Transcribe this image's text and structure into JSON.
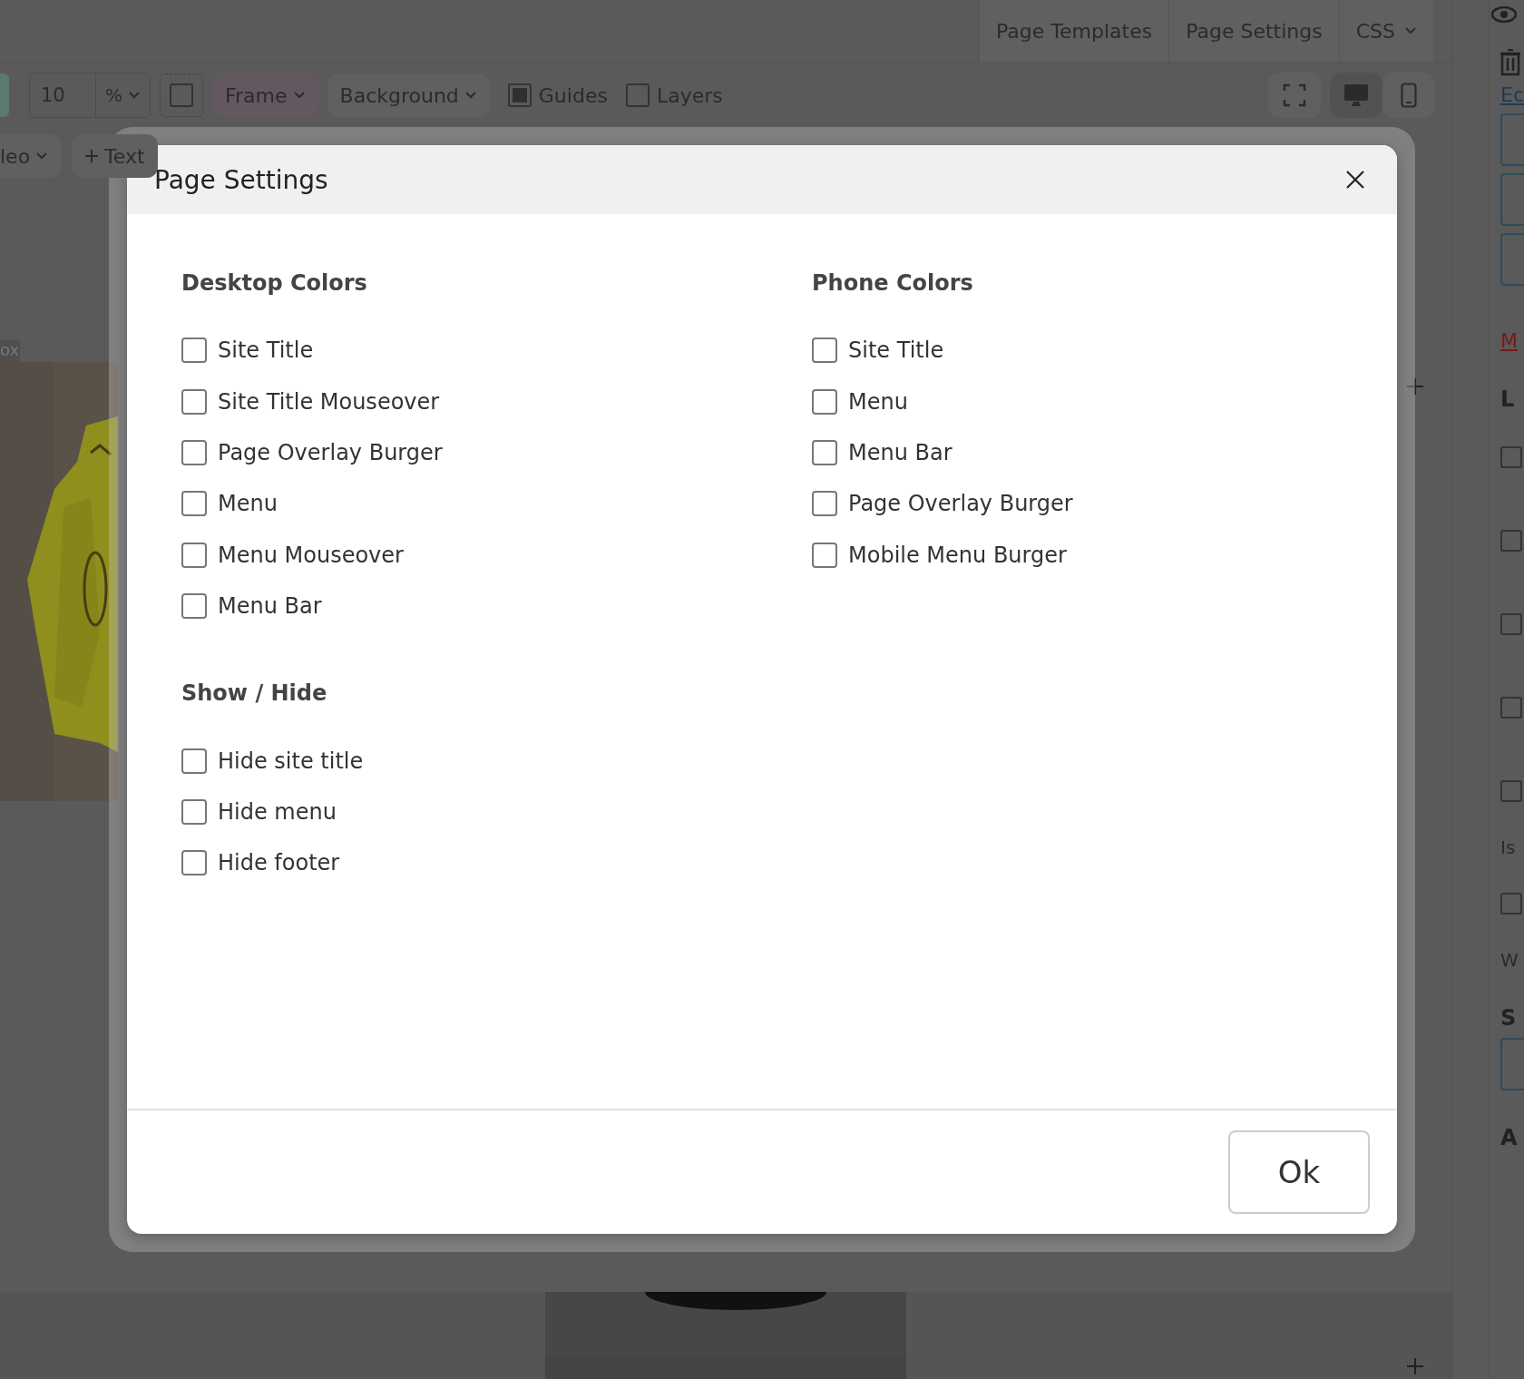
{
  "top_tabs": [
    "Page Templates",
    "Page Settings"
  ],
  "css_menu": "CSS",
  "toolbar": {
    "size_value": "10",
    "size_unit": "%",
    "frame": "Frame",
    "background": "Background",
    "toggles": [
      {
        "label": "Guides",
        "checked": true
      },
      {
        "label": "Layers",
        "checked": false
      }
    ]
  },
  "insert_bar": {
    "video_menu": "leo",
    "add_text": "Text"
  },
  "canvas_label": "ox",
  "sidebar": [
    {
      "kind": "link",
      "text": "Ec"
    },
    {
      "kind": "field"
    },
    {
      "kind": "field"
    },
    {
      "kind": "field"
    },
    {
      "kind": "alert",
      "text": "M"
    },
    {
      "kind": "heading",
      "text": "L"
    },
    {
      "kind": "check",
      "checked": false
    },
    {
      "kind": "check",
      "checked": false
    },
    {
      "kind": "check",
      "checked": false
    },
    {
      "kind": "check",
      "checked": false
    },
    {
      "kind": "check",
      "checked": false
    },
    {
      "kind": "text",
      "text": "Is"
    },
    {
      "kind": "check",
      "checked": false
    },
    {
      "kind": "text",
      "text": "W"
    },
    {
      "kind": "heading",
      "text": "S"
    },
    {
      "kind": "field"
    },
    {
      "kind": "heading",
      "text": "A"
    }
  ],
  "dialog": {
    "title": "Page Settings",
    "columns": [
      [
        {
          "heading": "Desktop Colors",
          "options": [
            {
              "label": "Site Title",
              "checked": false
            },
            {
              "label": "Site Title Mouseover",
              "checked": false
            },
            {
              "label": "Page Overlay Burger",
              "checked": false
            },
            {
              "label": "Menu",
              "checked": false
            },
            {
              "label": "Menu Mouseover",
              "checked": false
            },
            {
              "label": "Menu Bar",
              "checked": false
            }
          ]
        },
        {
          "heading": "Show / Hide",
          "options": [
            {
              "label": "Hide site title",
              "checked": false
            },
            {
              "label": "Hide menu",
              "checked": false
            },
            {
              "label": "Hide footer",
              "checked": false
            }
          ]
        }
      ],
      [
        {
          "heading": "Phone Colors",
          "options": [
            {
              "label": "Site Title",
              "checked": false
            },
            {
              "label": "Menu",
              "checked": false
            },
            {
              "label": "Menu Bar",
              "checked": false
            },
            {
              "label": "Page Overlay Burger",
              "checked": false
            },
            {
              "label": "Mobile Menu Burger",
              "checked": false
            }
          ]
        }
      ]
    ],
    "ok": "Ok"
  }
}
